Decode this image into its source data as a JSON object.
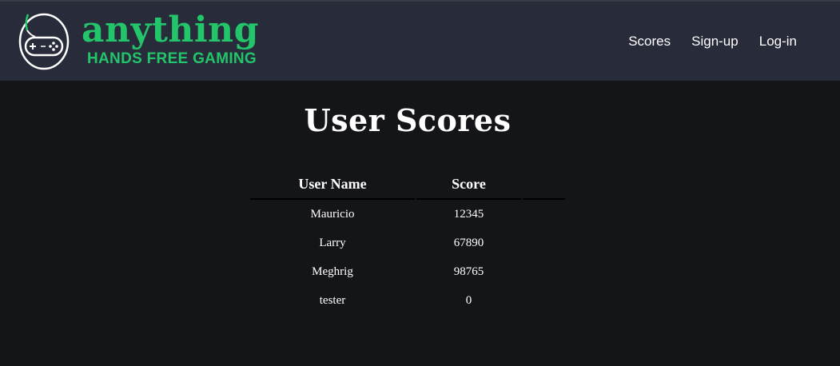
{
  "brand": {
    "name": "anything",
    "tagline": "HANDS FREE GAMING",
    "color": "#22c56a"
  },
  "nav": {
    "items": [
      {
        "label": "Scores"
      },
      {
        "label": "Sign-up"
      },
      {
        "label": "Log-in"
      }
    ]
  },
  "page": {
    "title": "User Scores"
  },
  "table": {
    "headers": [
      "User Name",
      "Score"
    ],
    "rows": [
      [
        "Mauricio",
        "12345"
      ],
      [
        "Larry",
        "67890"
      ],
      [
        "Meghrig",
        "98765"
      ],
      [
        "tester",
        "0"
      ]
    ]
  }
}
